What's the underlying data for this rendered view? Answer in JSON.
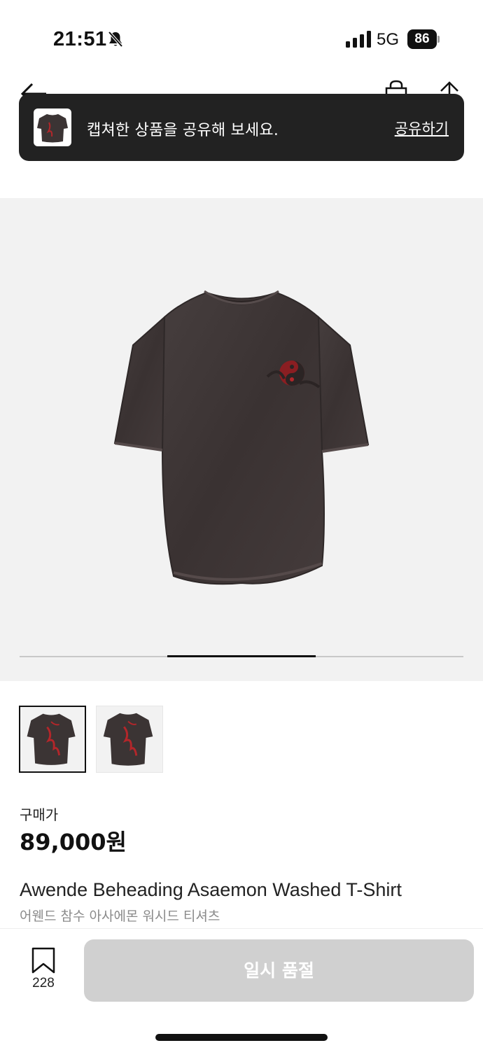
{
  "status_bar": {
    "time": "21:51",
    "network": "5G",
    "battery": "86"
  },
  "nav": {
    "back_icon": "arrow-left-icon",
    "bag_icon": "shopping-bag-icon",
    "share_icon": "share-arrow-icon"
  },
  "toast": {
    "message": "캡쳐한 상품을 공유해 보세요.",
    "action": "공유하기"
  },
  "carousel": {
    "slide_count": 3,
    "active_slide": 2
  },
  "thumbnails": [
    {
      "name": "thumbnail-1",
      "selected": true
    },
    {
      "name": "thumbnail-2",
      "selected": false
    }
  ],
  "product": {
    "price_label": "구매가",
    "price": "89,000원",
    "name_en": "Awende Beheading Asaemon Washed T-Shirt",
    "name_ko": "어웬드 참수 아사에몬 워시드 티셔츠"
  },
  "bottom_bar": {
    "bookmark_count": "228",
    "button_label": "일시 품절"
  },
  "colors": {
    "toast_bg": "#222222",
    "image_bg": "#f2f2f2",
    "disabled_button": "#d0d0d0",
    "shirt": "#3b3434",
    "graphic_red": "#b3262a"
  }
}
